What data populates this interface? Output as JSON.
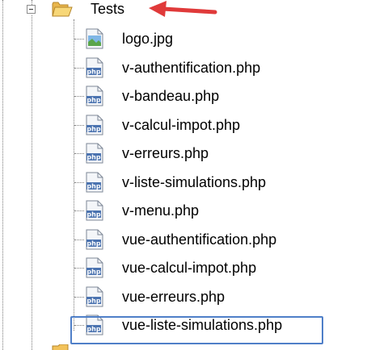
{
  "folder": {
    "name": "Tests",
    "expanded": true,
    "icon": "folder-open-icon"
  },
  "files": [
    {
      "name": "logo.jpg",
      "icon": "image-file-icon"
    },
    {
      "name": "v-authentification.php",
      "icon": "php-file-icon"
    },
    {
      "name": "v-bandeau.php",
      "icon": "php-file-icon"
    },
    {
      "name": "v-calcul-impot.php",
      "icon": "php-file-icon"
    },
    {
      "name": "v-erreurs.php",
      "icon": "php-file-icon"
    },
    {
      "name": "v-liste-simulations.php",
      "icon": "php-file-icon"
    },
    {
      "name": "v-menu.php",
      "icon": "php-file-icon"
    },
    {
      "name": "vue-authentification.php",
      "icon": "php-file-icon"
    },
    {
      "name": "vue-calcul-impot.php",
      "icon": "php-file-icon"
    },
    {
      "name": "vue-erreurs.php",
      "icon": "php-file-icon"
    },
    {
      "name": "vue-liste-simulations.php",
      "icon": "php-file-icon",
      "selected": true
    }
  ],
  "icon_text": {
    "php": "php"
  },
  "colors": {
    "selection_border": "#4f7fc8",
    "annotation_arrow": "#e03a3a",
    "folder": "#f2c25a",
    "php_icon": "#4b73b0"
  }
}
